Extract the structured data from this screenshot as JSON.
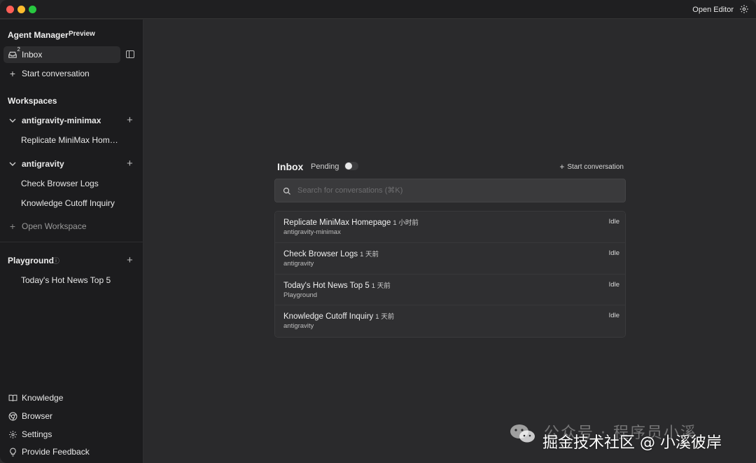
{
  "titlebar": {
    "open_editor": "Open Editor"
  },
  "sidebar": {
    "title": "Agent Manager",
    "badge": "Preview",
    "inbox_label": "Inbox",
    "inbox_count": "2",
    "start_conversation": "Start conversation",
    "workspaces_heading": "Workspaces",
    "workspaces": [
      {
        "name": "antigravity-minimax",
        "items": [
          "Replicate MiniMax Homepage"
        ]
      },
      {
        "name": "antigravity",
        "items": [
          "Check Browser Logs",
          "Knowledge Cutoff Inquiry"
        ]
      }
    ],
    "open_workspace": "Open Workspace",
    "playground_heading": "Playground",
    "playground_items": [
      "Today's Hot News Top 5"
    ],
    "footer": [
      "Knowledge",
      "Browser",
      "Settings",
      "Provide Feedback"
    ]
  },
  "main": {
    "inbox_title": "Inbox",
    "pending_label": "Pending",
    "pending_on": false,
    "start_conversation": "Start conversation",
    "search_placeholder": "Search for conversations (⌘K)",
    "conversations": [
      {
        "title": "Replicate MiniMax Homepage",
        "time": "1 小时前",
        "workspace": "antigravity-minimax",
        "status": "Idle"
      },
      {
        "title": "Check Browser Logs",
        "time": "1 天前",
        "workspace": "antigravity",
        "status": "Idle"
      },
      {
        "title": "Today's Hot News Top 5",
        "time": "1 天前",
        "workspace": "Playground",
        "status": "Idle"
      },
      {
        "title": "Knowledge Cutoff Inquiry",
        "time": "1 天前",
        "workspace": "antigravity",
        "status": "Idle"
      }
    ]
  },
  "watermark": {
    "top": "公众号 · 程序员小溪",
    "bottom": "掘金技术社区 @ 小溪彼岸"
  }
}
